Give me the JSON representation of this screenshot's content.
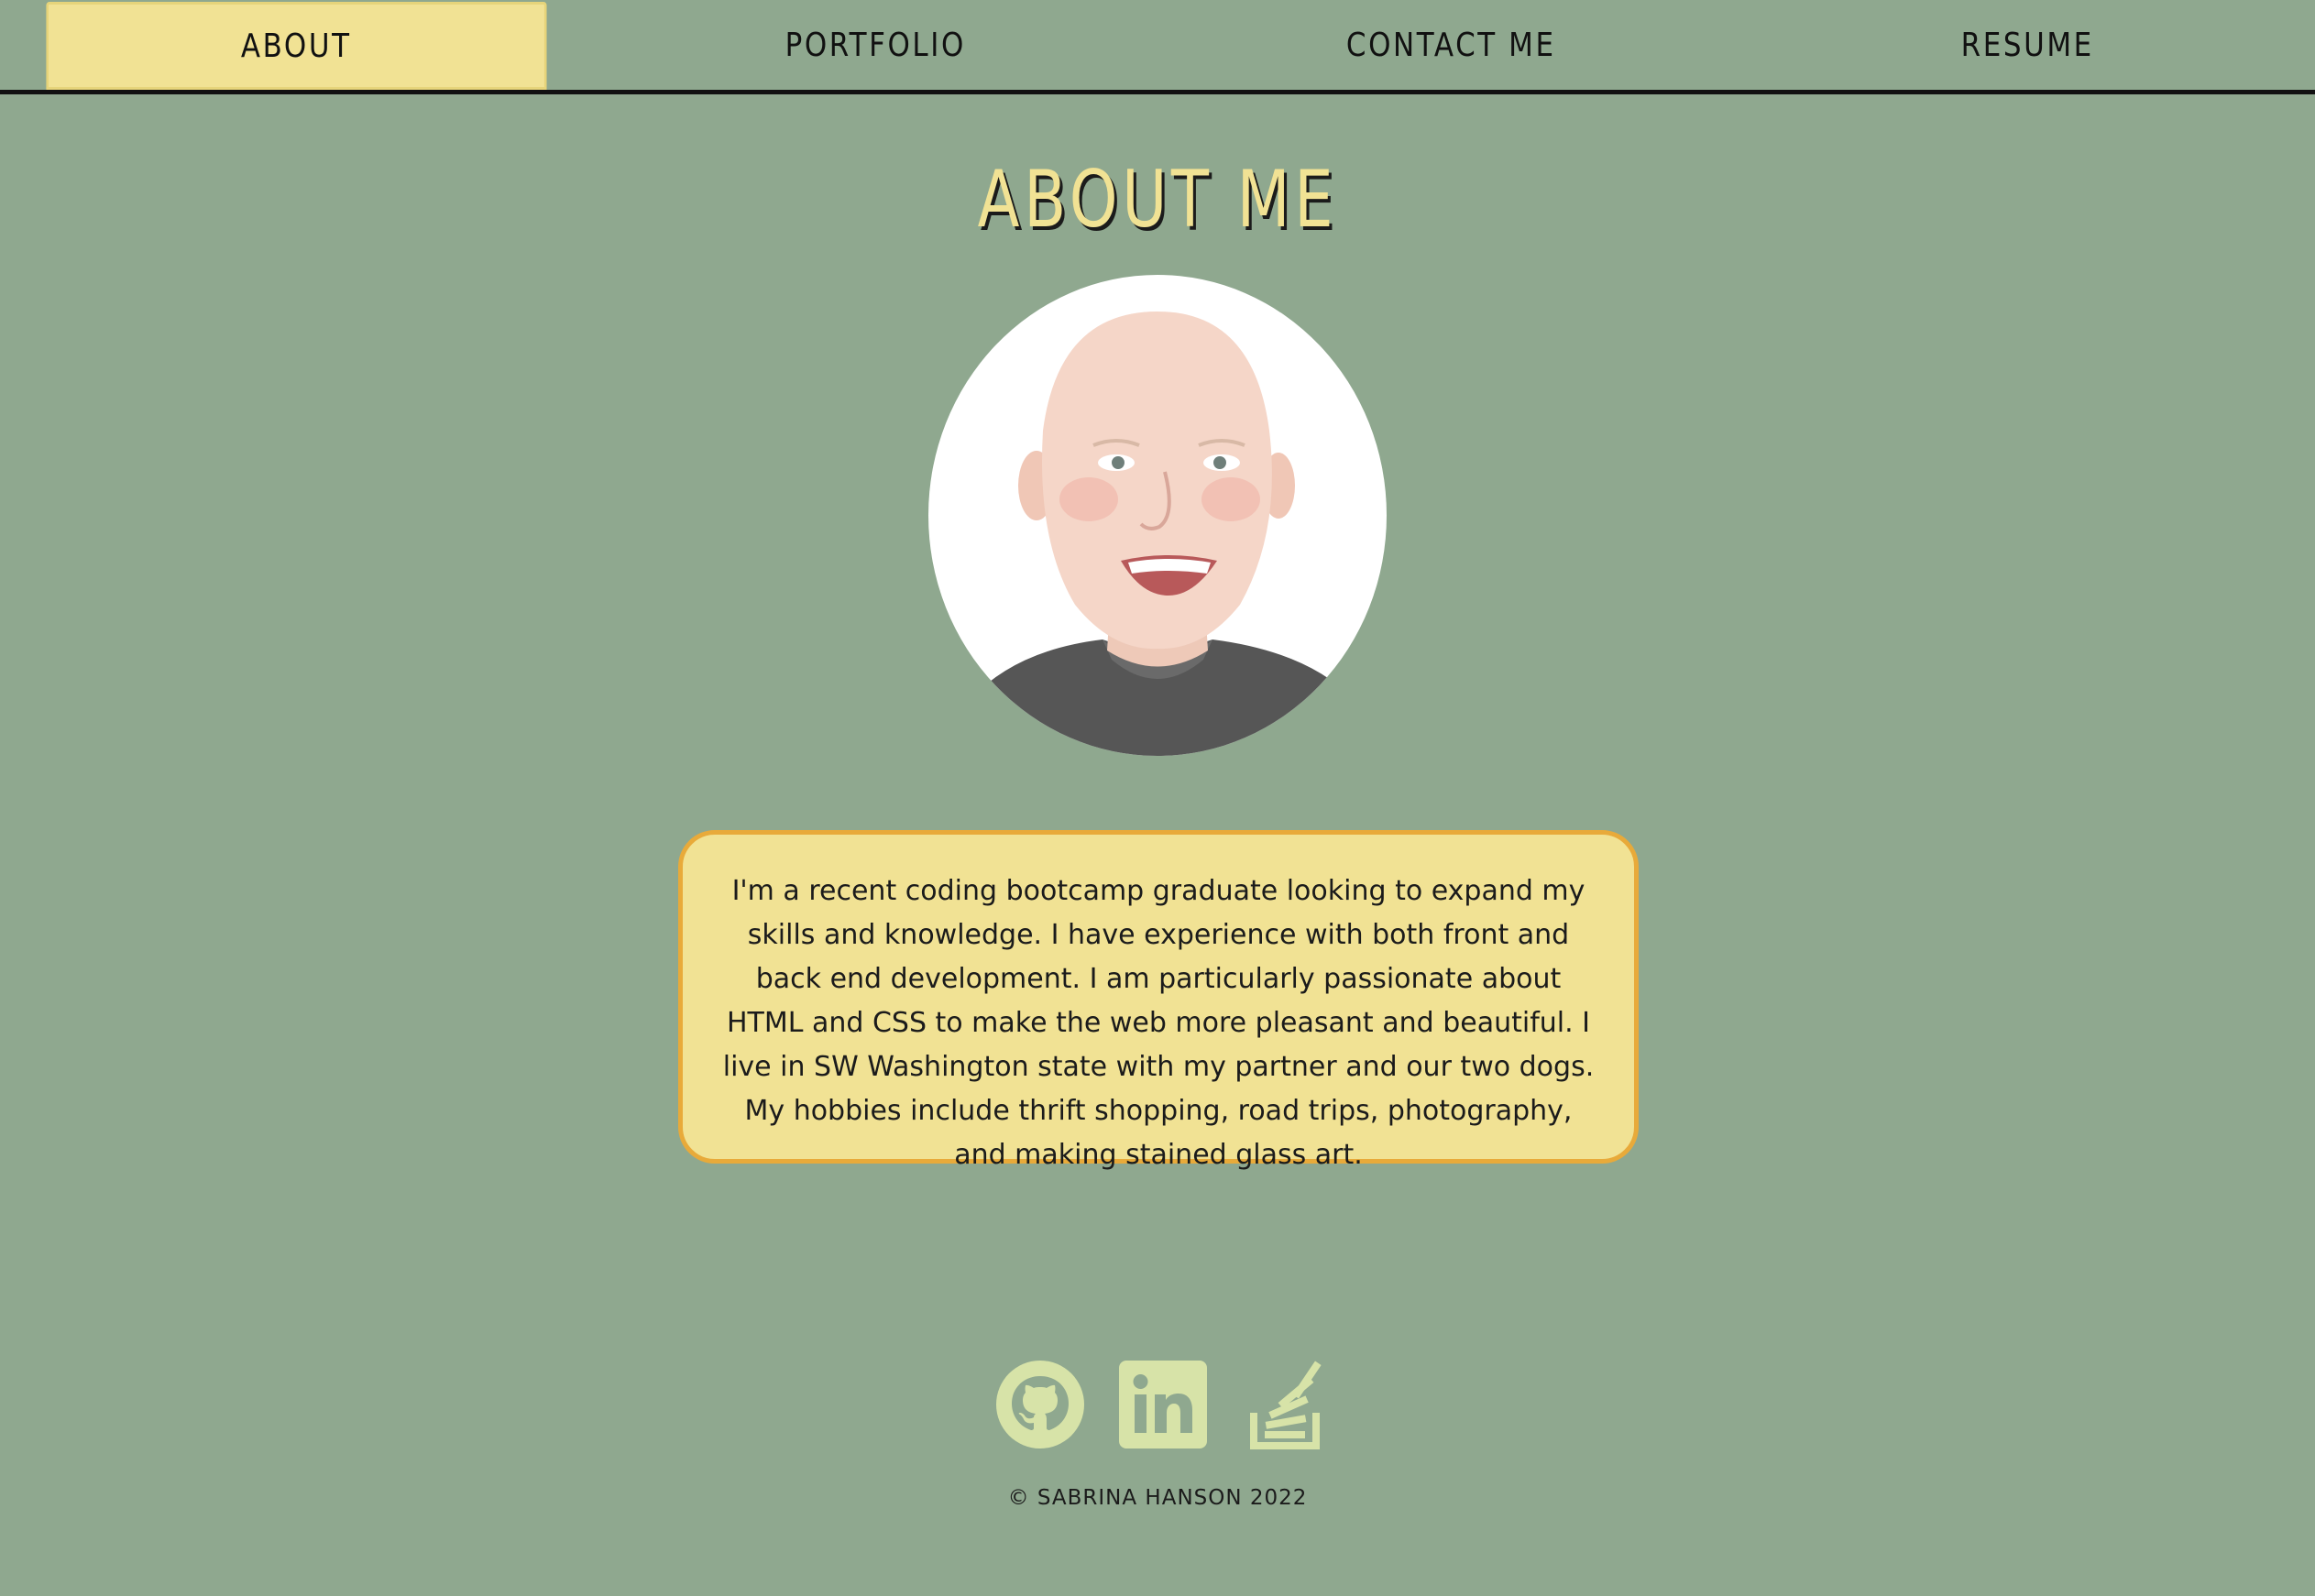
{
  "nav": {
    "items": [
      {
        "label": "ABOUT",
        "active": true
      },
      {
        "label": "PORTFOLIO",
        "active": false
      },
      {
        "label": "CONTACT ME",
        "active": false
      },
      {
        "label": "RESUME",
        "active": false
      }
    ]
  },
  "main": {
    "title": "ABOUT ME",
    "bio": "I'm a recent coding bootcamp graduate looking to expand my skills and knowledge. I have experience with both front and back end development. I am particularly passionate about HTML and CSS to make the web more pleasant and beautiful. I live in SW Washington state with my partner and our two dogs. My hobbies include thrift shopping, road trips, photography, and making stained glass art."
  },
  "social": {
    "icons": [
      "github-icon",
      "linkedin-icon",
      "stackoverflow-icon"
    ]
  },
  "footer": {
    "copyright": "© SABRINA HANSON 2022"
  },
  "colors": {
    "background": "#8fa88f",
    "accent": "#f1e294",
    "border_accent": "#e8aa3a",
    "icon": "#d7e3a8",
    "text": "#1b1b1b"
  }
}
